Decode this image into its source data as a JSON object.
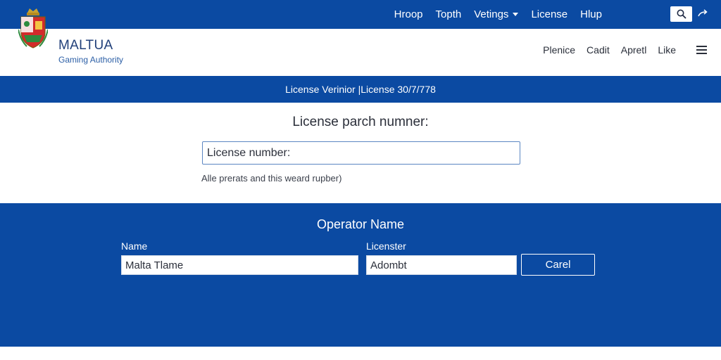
{
  "topnav": {
    "items": [
      {
        "label": "Hroop"
      },
      {
        "label": "Topth"
      },
      {
        "label": "Vetings",
        "dropdown": true
      },
      {
        "label": "License"
      },
      {
        "label": "Hlup"
      }
    ]
  },
  "header": {
    "brand_name": "MALTUA",
    "brand_sub": "Gaming Authority",
    "secondary_nav": [
      "Plenice",
      "Cadit",
      "Apretl",
      "Like"
    ]
  },
  "banner": {
    "text": "License Verinior |License 30/7/778"
  },
  "search": {
    "title": "License parch numner:",
    "input_value": "License number:",
    "hint": "Alle prerats and this weard rupber)"
  },
  "operator": {
    "title": "Operator Name",
    "name_label": "Name",
    "name_value": "Malta Tlame",
    "licenster_label": "Licenster",
    "licenster_value": "Adombt",
    "cancel_label": "Carel"
  },
  "colors": {
    "primary_blue": "#0b4aa2",
    "white": "#ffffff"
  },
  "icons": [
    "search-icon",
    "share-icon",
    "menu-icon",
    "crest-logo",
    "chevron-down-icon"
  ]
}
